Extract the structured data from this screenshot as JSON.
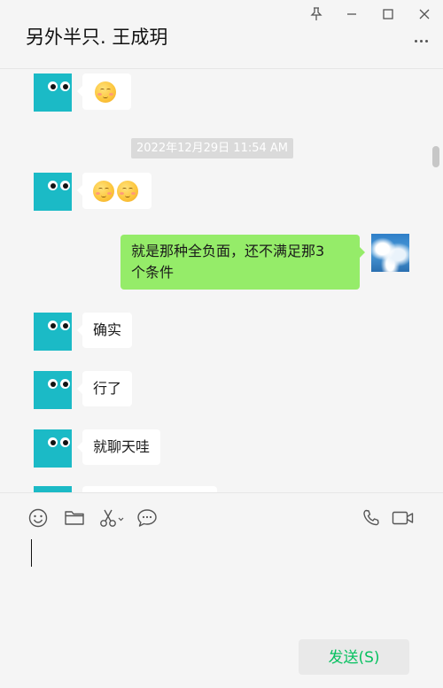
{
  "window": {
    "title": "另外半只. 王成玥",
    "controls": [
      "pin-icon",
      "minimize-icon",
      "maximize-icon",
      "close-icon"
    ]
  },
  "chat": {
    "timestamp": "2022年12月29日 11:54 AM",
    "messages": [
      {
        "sender": "contact",
        "type": "emoji",
        "emojis": [
          "smiling-blush-emoji"
        ]
      },
      {
        "sender": "contact",
        "type": "emoji",
        "emojis": [
          "smiling-blush-emoji",
          "smiling-blush-emoji"
        ]
      },
      {
        "sender": "me",
        "type": "text",
        "lines": [
          "就是那种全负面，还不满足那3",
          "个条件"
        ]
      },
      {
        "sender": "contact",
        "type": "text",
        "text": "确实"
      },
      {
        "sender": "contact",
        "type": "text",
        "text": "行了"
      },
      {
        "sender": "contact",
        "type": "text",
        "text": "就聊天哇"
      }
    ]
  },
  "toolbar": {
    "left_icons": [
      "emoji-icon",
      "folder-icon",
      "scissors-icon",
      "chat-bubble-icon"
    ],
    "right_icons": [
      "phone-icon",
      "video-call-icon"
    ]
  },
  "input": {
    "value": ""
  },
  "send_button": {
    "label": "发送(S)"
  },
  "colors": {
    "sent_bubble": "#95ec69",
    "received_bubble": "#ffffff",
    "send_text": "#07c160",
    "avatar_contact": "#1bbac6"
  }
}
